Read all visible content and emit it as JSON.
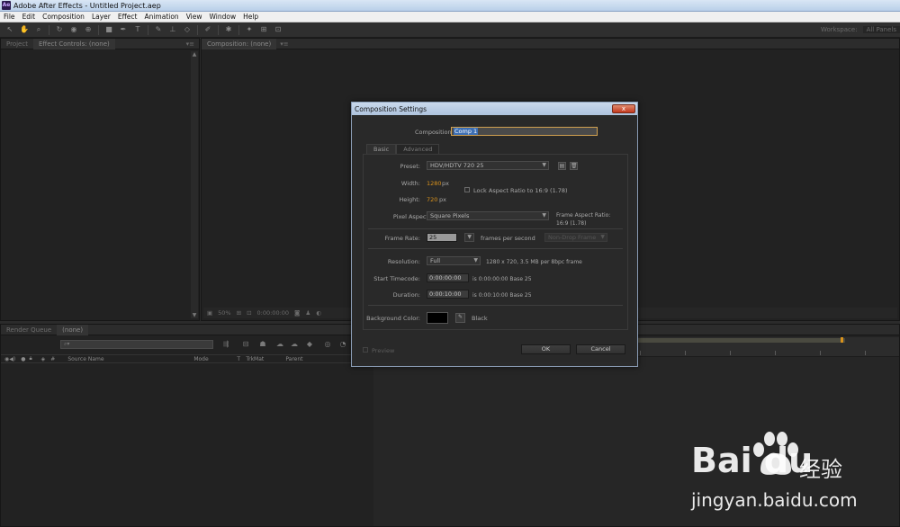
{
  "window": {
    "title": "Adobe After Effects - Untitled Project.aep",
    "icon": "Ae"
  },
  "menu": [
    "File",
    "Edit",
    "Composition",
    "Layer",
    "Effect",
    "Animation",
    "View",
    "Window",
    "Help"
  ],
  "workspace": {
    "label": "Workspace:",
    "value": "All Panels"
  },
  "left_panel": {
    "tabs": [
      "Project",
      "Effect Controls: (none)"
    ]
  },
  "viewer": {
    "tab": "Composition: (none)",
    "zoom": "50%",
    "timecode": "0:00:00:00"
  },
  "timeline": {
    "tabs": [
      "Render Queue",
      "(none)"
    ],
    "columns": [
      "#",
      "Source Name",
      "Mode",
      "T",
      "TrkMat",
      "Parent"
    ]
  },
  "dialog": {
    "title": "Composition Settings",
    "close": "x",
    "name_label": "Composition Name:",
    "name_value": "Comp 1",
    "tabs": [
      "Basic",
      "Advanced"
    ],
    "preset_label": "Preset:",
    "preset_value": "HDV/HDTV 720 25",
    "width_label": "Width:",
    "width_value": "1280",
    "height_label": "Height:",
    "height_value": "720",
    "px": "px",
    "lock_label": "Lock Aspect Ratio to 16:9 (1.78)",
    "par_label": "Pixel Aspect Ratio:",
    "par_value": "Square Pixels",
    "frame_aspect_label": "Frame Aspect Ratio:",
    "frame_aspect_value": "16:9 (1.78)",
    "fps_label": "Frame Rate:",
    "fps_value": "25",
    "fps_unit": "frames per second",
    "drop_frame": "Non-Drop Frame",
    "resolution_label": "Resolution:",
    "resolution_value": "Full",
    "resolution_info": "1280 x 720, 3.5 MB per 8bpc frame",
    "start_label": "Start Timecode:",
    "start_value": "0:00:00:00",
    "start_info": "is 0:00:00:00  Base 25",
    "duration_label": "Duration:",
    "duration_value": "0:00:10:00",
    "duration_info": "is 0:00:10:00  Base 25",
    "bg_label": "Background Color:",
    "bg_color_name": "Black",
    "bg_color": "#000000",
    "preview_label": "Preview",
    "ok": "OK",
    "cancel": "Cancel"
  },
  "watermark": {
    "logo": "Bai du",
    "cn": "经验",
    "url": "jingyan.baidu.com"
  },
  "colors": {
    "accent_orange": "#d9921c",
    "selection_blue": "#3d6fb4"
  }
}
